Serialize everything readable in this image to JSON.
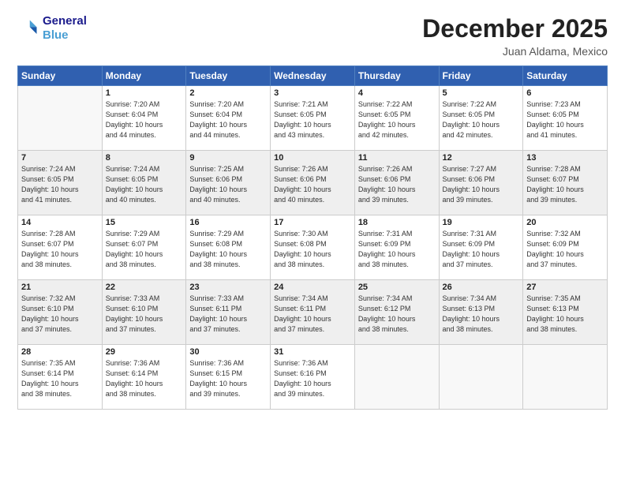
{
  "header": {
    "logo_line1": "General",
    "logo_line2": "Blue",
    "title": "December 2025",
    "subtitle": "Juan Aldama, Mexico"
  },
  "days_of_week": [
    "Sunday",
    "Monday",
    "Tuesday",
    "Wednesday",
    "Thursday",
    "Friday",
    "Saturday"
  ],
  "weeks": [
    [
      {
        "day": "",
        "detail": ""
      },
      {
        "day": "1",
        "detail": "Sunrise: 7:20 AM\nSunset: 6:04 PM\nDaylight: 10 hours\nand 44 minutes."
      },
      {
        "day": "2",
        "detail": "Sunrise: 7:20 AM\nSunset: 6:04 PM\nDaylight: 10 hours\nand 44 minutes."
      },
      {
        "day": "3",
        "detail": "Sunrise: 7:21 AM\nSunset: 6:05 PM\nDaylight: 10 hours\nand 43 minutes."
      },
      {
        "day": "4",
        "detail": "Sunrise: 7:22 AM\nSunset: 6:05 PM\nDaylight: 10 hours\nand 42 minutes."
      },
      {
        "day": "5",
        "detail": "Sunrise: 7:22 AM\nSunset: 6:05 PM\nDaylight: 10 hours\nand 42 minutes."
      },
      {
        "day": "6",
        "detail": "Sunrise: 7:23 AM\nSunset: 6:05 PM\nDaylight: 10 hours\nand 41 minutes."
      }
    ],
    [
      {
        "day": "7",
        "detail": "Sunrise: 7:24 AM\nSunset: 6:05 PM\nDaylight: 10 hours\nand 41 minutes."
      },
      {
        "day": "8",
        "detail": "Sunrise: 7:24 AM\nSunset: 6:05 PM\nDaylight: 10 hours\nand 40 minutes."
      },
      {
        "day": "9",
        "detail": "Sunrise: 7:25 AM\nSunset: 6:06 PM\nDaylight: 10 hours\nand 40 minutes."
      },
      {
        "day": "10",
        "detail": "Sunrise: 7:26 AM\nSunset: 6:06 PM\nDaylight: 10 hours\nand 40 minutes."
      },
      {
        "day": "11",
        "detail": "Sunrise: 7:26 AM\nSunset: 6:06 PM\nDaylight: 10 hours\nand 39 minutes."
      },
      {
        "day": "12",
        "detail": "Sunrise: 7:27 AM\nSunset: 6:06 PM\nDaylight: 10 hours\nand 39 minutes."
      },
      {
        "day": "13",
        "detail": "Sunrise: 7:28 AM\nSunset: 6:07 PM\nDaylight: 10 hours\nand 39 minutes."
      }
    ],
    [
      {
        "day": "14",
        "detail": "Sunrise: 7:28 AM\nSunset: 6:07 PM\nDaylight: 10 hours\nand 38 minutes."
      },
      {
        "day": "15",
        "detail": "Sunrise: 7:29 AM\nSunset: 6:07 PM\nDaylight: 10 hours\nand 38 minutes."
      },
      {
        "day": "16",
        "detail": "Sunrise: 7:29 AM\nSunset: 6:08 PM\nDaylight: 10 hours\nand 38 minutes."
      },
      {
        "day": "17",
        "detail": "Sunrise: 7:30 AM\nSunset: 6:08 PM\nDaylight: 10 hours\nand 38 minutes."
      },
      {
        "day": "18",
        "detail": "Sunrise: 7:31 AM\nSunset: 6:09 PM\nDaylight: 10 hours\nand 38 minutes."
      },
      {
        "day": "19",
        "detail": "Sunrise: 7:31 AM\nSunset: 6:09 PM\nDaylight: 10 hours\nand 37 minutes."
      },
      {
        "day": "20",
        "detail": "Sunrise: 7:32 AM\nSunset: 6:09 PM\nDaylight: 10 hours\nand 37 minutes."
      }
    ],
    [
      {
        "day": "21",
        "detail": "Sunrise: 7:32 AM\nSunset: 6:10 PM\nDaylight: 10 hours\nand 37 minutes."
      },
      {
        "day": "22",
        "detail": "Sunrise: 7:33 AM\nSunset: 6:10 PM\nDaylight: 10 hours\nand 37 minutes."
      },
      {
        "day": "23",
        "detail": "Sunrise: 7:33 AM\nSunset: 6:11 PM\nDaylight: 10 hours\nand 37 minutes."
      },
      {
        "day": "24",
        "detail": "Sunrise: 7:34 AM\nSunset: 6:11 PM\nDaylight: 10 hours\nand 37 minutes."
      },
      {
        "day": "25",
        "detail": "Sunrise: 7:34 AM\nSunset: 6:12 PM\nDaylight: 10 hours\nand 38 minutes."
      },
      {
        "day": "26",
        "detail": "Sunrise: 7:34 AM\nSunset: 6:13 PM\nDaylight: 10 hours\nand 38 minutes."
      },
      {
        "day": "27",
        "detail": "Sunrise: 7:35 AM\nSunset: 6:13 PM\nDaylight: 10 hours\nand 38 minutes."
      }
    ],
    [
      {
        "day": "28",
        "detail": "Sunrise: 7:35 AM\nSunset: 6:14 PM\nDaylight: 10 hours\nand 38 minutes."
      },
      {
        "day": "29",
        "detail": "Sunrise: 7:36 AM\nSunset: 6:14 PM\nDaylight: 10 hours\nand 38 minutes."
      },
      {
        "day": "30",
        "detail": "Sunrise: 7:36 AM\nSunset: 6:15 PM\nDaylight: 10 hours\nand 39 minutes."
      },
      {
        "day": "31",
        "detail": "Sunrise: 7:36 AM\nSunset: 6:16 PM\nDaylight: 10 hours\nand 39 minutes."
      },
      {
        "day": "",
        "detail": ""
      },
      {
        "day": "",
        "detail": ""
      },
      {
        "day": "",
        "detail": ""
      }
    ]
  ]
}
